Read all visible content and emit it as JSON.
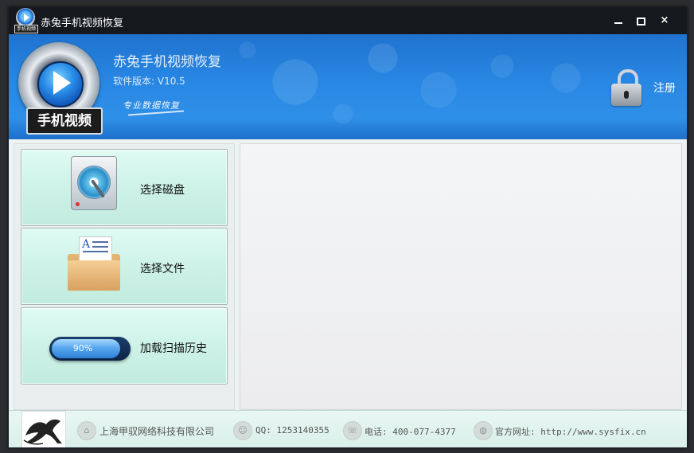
{
  "window": {
    "title": "赤兔手机视频恢复",
    "icon_tag": "手机视频",
    "controls": {
      "minimize": "minimize-icon",
      "maximize": "maximize-icon",
      "close": "×"
    }
  },
  "header": {
    "logo_label": "手机视频",
    "app_name": "赤兔手机视频恢复",
    "version": "软件版本: V10.5",
    "slogan": "专业数据恢复",
    "register_label": "注册",
    "lock_icon": "lock-icon"
  },
  "actions": [
    {
      "label": "选择磁盘",
      "icon": "hard-disk-icon"
    },
    {
      "label": "选择文件",
      "icon": "folder-document-icon"
    },
    {
      "label": "加载扫描历史",
      "icon": "progress-bar-icon",
      "progress_text": "90%",
      "progress_value": 0.9
    }
  ],
  "footer": {
    "company": "上海甲驭网络科技有限公司",
    "qq": "QQ: 1253140355",
    "phone": "电话: 400-077-4377",
    "website": "官方网址: http://www.sysfix.cn"
  },
  "colors": {
    "header_blue": "#2887e3",
    "button_mint": "#cdf2e7",
    "titlebar": "#15181d"
  }
}
